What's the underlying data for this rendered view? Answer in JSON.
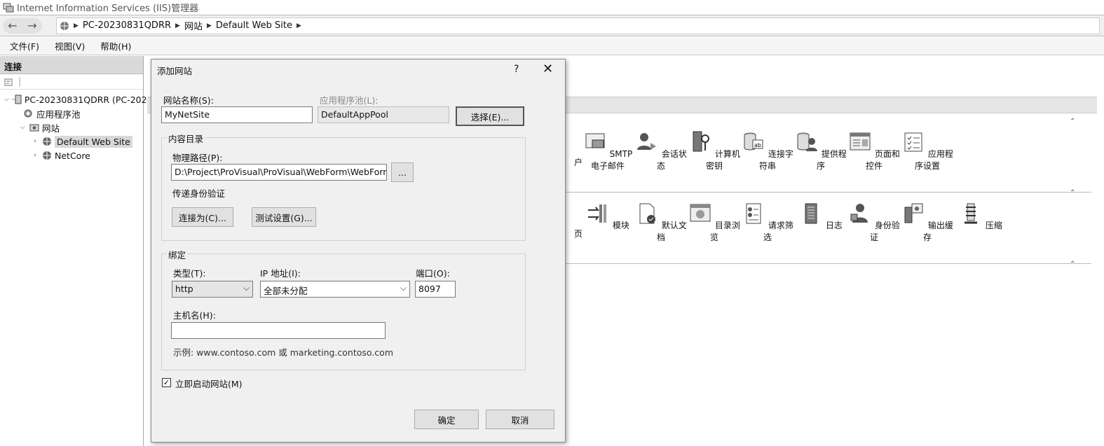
{
  "window": {
    "title": "Internet Information Services (IIS)管理器"
  },
  "address": {
    "crumbs": [
      "PC-20230831QDRR",
      "网站",
      "Default Web Site"
    ]
  },
  "menu": {
    "file": "文件(F)",
    "view": "视图(V)",
    "help": "帮助(H)"
  },
  "connections": {
    "header": "连接",
    "tree": {
      "server": "PC-20230831QDRR (PC-202",
      "app_pools": "应用程序池",
      "sites": "网站",
      "default_site": "Default Web Site",
      "netcore": "NetCore"
    }
  },
  "features": {
    "row1": [
      "户",
      "SMTP 电子邮件",
      "会话状态",
      "计算机密钥",
      "连接字符串",
      "提供程序",
      "页面和控件",
      "应用程序设置"
    ],
    "row2": [
      "页",
      "模块",
      "默认文档",
      "目录浏览",
      "请求筛选",
      "日志",
      "身份验证",
      "输出缓存",
      "压缩"
    ]
  },
  "dialog": {
    "title": "添加网站",
    "help": "?",
    "close": "✕",
    "site_name_label": "网站名称(S):",
    "site_name_value": "MyNetSite",
    "app_pool_label": "应用程序池(L):",
    "app_pool_value": "DefaultAppPool",
    "select_button": "选择(E)...",
    "content_group": "内容目录",
    "physical_path_label": "物理路径(P):",
    "physical_path_value": "D:\\Project\\ProVisual\\ProVisual\\WebForm\\WebForm",
    "browse_button": "...",
    "pass_through_label": "传递身份验证",
    "connect_as_button": "连接为(C)...",
    "test_settings_button": "测试设置(G)...",
    "binding_group": "绑定",
    "type_label": "类型(T):",
    "type_value": "http",
    "ip_label": "IP 地址(I):",
    "ip_value": "全部未分配",
    "port_label": "端口(O):",
    "port_value": "8097",
    "host_label": "主机名(H):",
    "host_value": "",
    "example_text": "示例: www.contoso.com 或 marketing.contoso.com",
    "start_now_label": "立即启动网站(M)",
    "start_now_checked": true,
    "ok_button": "确定",
    "cancel_button": "取消"
  }
}
